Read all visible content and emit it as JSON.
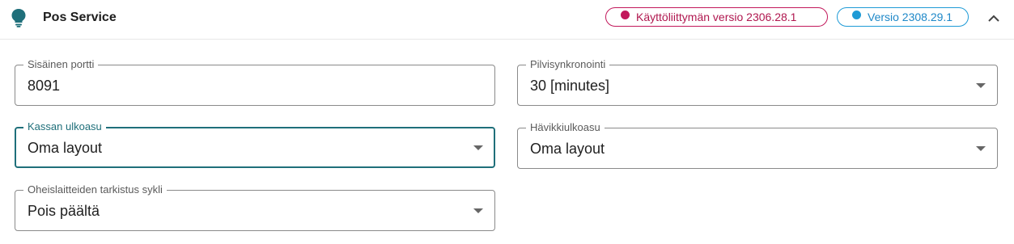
{
  "header": {
    "title": "Pos Service",
    "ui_version_chip": "Käyttöliittymän versio 2306.28.1",
    "version_chip": "Versio 2308.29.1"
  },
  "fields": {
    "internal_port": {
      "label": "Sisäinen portti",
      "value": "8091"
    },
    "cloud_sync": {
      "label": "Pilvisynkronointi",
      "value": "30 [minutes]"
    },
    "register_layout": {
      "label": "Kassan ulkoasu",
      "value": "Oma layout"
    },
    "waste_layout": {
      "label": "Hävikkiulkoasu",
      "value": "Oma layout"
    },
    "peripheral_check": {
      "label": "Oheislaitteiden tarkistus sykli",
      "value": "Pois päältä"
    }
  },
  "colors": {
    "accent": "#1f6f7a",
    "error": "#c2185b",
    "info": "#1e9ad6"
  },
  "icons": {
    "service": "lightbulb-icon",
    "ui_version": "alert-circle-icon",
    "version": "check-circle-icon",
    "collapse": "chevron-up-icon",
    "dropdown": "caret-down-icon"
  }
}
